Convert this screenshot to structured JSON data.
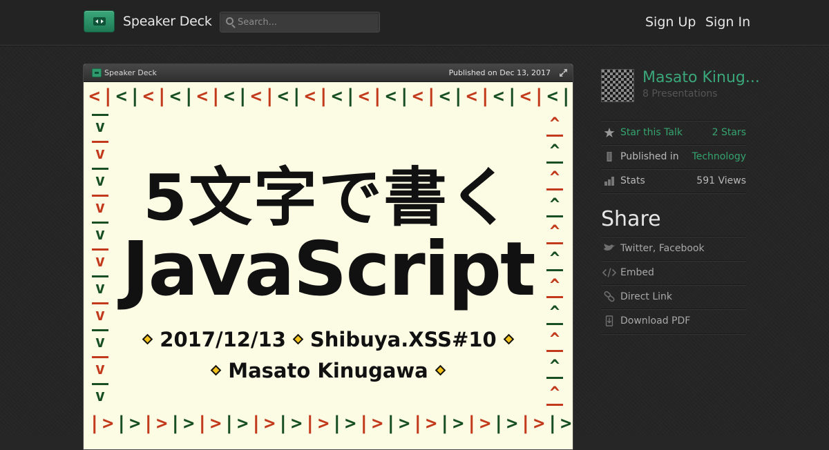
{
  "header": {
    "brand": "Speaker Deck",
    "search_placeholder": "Search...",
    "sign_up": "Sign Up",
    "sign_in": "Sign In"
  },
  "player": {
    "brand": "Speaker Deck",
    "published": "Published on Dec 13, 2017",
    "slide": {
      "top_border": [
        "<",
        "|",
        "<",
        "|",
        "<",
        "|",
        "<",
        "|",
        "<",
        "|",
        "<",
        "|",
        "<",
        "|",
        "<",
        "|",
        "<",
        "|",
        "<",
        "|",
        "<",
        "|",
        "<",
        "|",
        "<",
        "|",
        "<",
        "|",
        "<",
        "|",
        "<",
        "|",
        "<",
        "|",
        "<",
        "|",
        "<",
        "|"
      ],
      "bottom_border": [
        "|",
        ">",
        "|",
        ">",
        "|",
        ">",
        "|",
        ">",
        "|",
        ">",
        "|",
        ">",
        "|",
        ">",
        "|",
        ">",
        "|",
        ">",
        "|",
        ">",
        "|",
        ">",
        "|",
        ">",
        "|",
        ">",
        "|",
        ">",
        "|",
        ">",
        "|",
        ">",
        "|",
        ">",
        "|",
        ">",
        "|"
      ],
      "left_border": [
        "v",
        "v",
        "v",
        "v",
        "v",
        "v",
        "v",
        "v",
        "v",
        "v",
        "v"
      ],
      "right_border": [
        "^",
        "^",
        "^",
        "^",
        "^",
        "^",
        "^",
        "^",
        "^",
        "^",
        "^"
      ],
      "title_jp": "5文字で書く",
      "title_en": "JavaScript",
      "date": "2017/12/13",
      "event": "Shibuya.XSS#10",
      "author": "Masato Kinugawa"
    }
  },
  "sidebar": {
    "author_name": "Masato Kinug...",
    "author_presentations": "8 Presentations",
    "star_label": "Star this Talk",
    "star_count": "2 Stars",
    "published_in_label": "Published in",
    "published_in_value": "Technology",
    "stats_label": "Stats",
    "stats_value": "591 Views",
    "share_title": "Share",
    "share_items": [
      {
        "label": "Twitter, Facebook",
        "icon": "bird-icon"
      },
      {
        "label": "Embed",
        "icon": "code-icon"
      },
      {
        "label": "Direct Link",
        "icon": "link-icon"
      },
      {
        "label": "Download PDF",
        "icon": "download-icon"
      }
    ]
  },
  "colors": {
    "accent_green": "#35a46f",
    "slide_bg": "#fcfbe4",
    "border_red": "#c2391b",
    "border_green": "#174f22",
    "diamond_yellow": "#f3c21a"
  }
}
